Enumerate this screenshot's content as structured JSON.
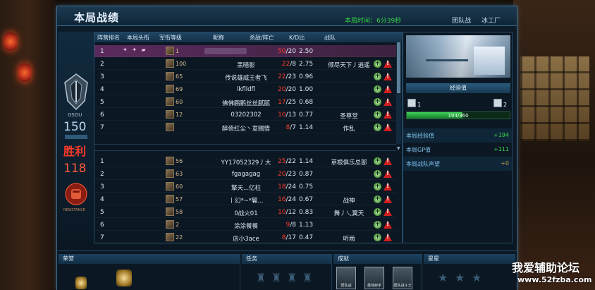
{
  "header": {
    "title": "本局战绩",
    "time_label": "本局时间：6分39秒",
    "team_label": "团队战",
    "team_name": "冰工厂"
  },
  "table": {
    "headers": [
      "阵营排名",
      "本局头衔",
      "军衔等级",
      "昵称",
      "杀敌/阵亡",
      "K/D比",
      "战队"
    ],
    "team1": [
      {
        "rank": "1",
        "level": "1",
        "name": "",
        "kills": "50",
        "deaths": "/20",
        "kd": "2.50",
        "team": ""
      },
      {
        "rank": "2",
        "level": "100",
        "name": "黑暗影",
        "kills": "22",
        "deaths": "/8",
        "kd": "2.75",
        "team": "倾尽天下丿逍遥"
      },
      {
        "rank": "3",
        "level": "65",
        "name": "传说雄威王者飞",
        "kills": "22",
        "deaths": "/23",
        "kd": "0.96",
        "team": ""
      },
      {
        "rank": "4",
        "level": "69",
        "name": "lkflldfl",
        "kills": "20",
        "deaths": "/20",
        "kd": "1.00",
        "team": ""
      },
      {
        "rank": "5",
        "level": "60",
        "name": "佛佛鹏鹏丝丝腻腻",
        "kills": "17",
        "deaths": "/25",
        "kd": "0.68",
        "team": ""
      },
      {
        "rank": "6",
        "level": "12",
        "name": "03202302",
        "kills": "10",
        "deaths": "/13",
        "kd": "0.77",
        "team": "圣尊堂"
      },
      {
        "rank": "7",
        "level": "",
        "name": "醉倚红尘丶意赐情",
        "kills": "8",
        "deaths": "/7",
        "kd": "1.14",
        "team": "作乱"
      }
    ],
    "team2": [
      {
        "rank": "1",
        "level": "56",
        "name": "YY17052329丿大",
        "kills": "25",
        "deaths": "/22",
        "kd": "1.14",
        "team": "草根俱乐总部"
      },
      {
        "rank": "2",
        "level": "63",
        "name": "fgagagag",
        "kills": "20",
        "deaths": "/23",
        "kd": "0.87",
        "team": ""
      },
      {
        "rank": "3",
        "level": "60",
        "name": "擎天...亿柱",
        "kills": "18",
        "deaths": "/24",
        "kd": "0.75",
        "team": ""
      },
      {
        "rank": "4",
        "level": "57",
        "name": "丨幻*~*鬈...",
        "kills": "16",
        "deaths": "/24",
        "kd": "0.67",
        "team": "战神"
      },
      {
        "rank": "5",
        "level": "58",
        "name": "0战火01",
        "kills": "10",
        "deaths": "/12",
        "kd": "0.83",
        "team": "舞丿乀翼天"
      },
      {
        "rank": "6",
        "level": "2",
        "name": "涂涂餐餐",
        "kills": "9",
        "deaths": "/8",
        "kd": "1.13",
        "team": ""
      },
      {
        "rank": "7",
        "level": "22",
        "name": "店小3ace",
        "kills": "8",
        "deaths": "/17",
        "kd": "0.47",
        "team": "听雨"
      }
    ],
    "plus": "+",
    "warn": "!"
  },
  "badges": {
    "gsd": "GSDU",
    "score1": "150",
    "result": "胜利",
    "score2": "118",
    "emblem2_label": "RESISTANCE"
  },
  "right": {
    "section_title": "经验值",
    "exp_left": "1",
    "exp_right": "2",
    "exp_progress": 0.54,
    "exp_text": "194/360",
    "stats": [
      {
        "label": "本局经验值",
        "value": "+194"
      },
      {
        "label": "本局GP值",
        "value": "+111"
      },
      {
        "label": "本局战队声望",
        "value": "+0"
      }
    ]
  },
  "bottom": {
    "honor": "荣誉",
    "task": "任务",
    "achievement": "成就",
    "star": "星星",
    "ach_items": [
      "团队战",
      "最佳射手",
      "团队战斗士"
    ]
  },
  "watermark": {
    "text": "我爱辅助论坛",
    "url": "www.52fzba.com"
  }
}
